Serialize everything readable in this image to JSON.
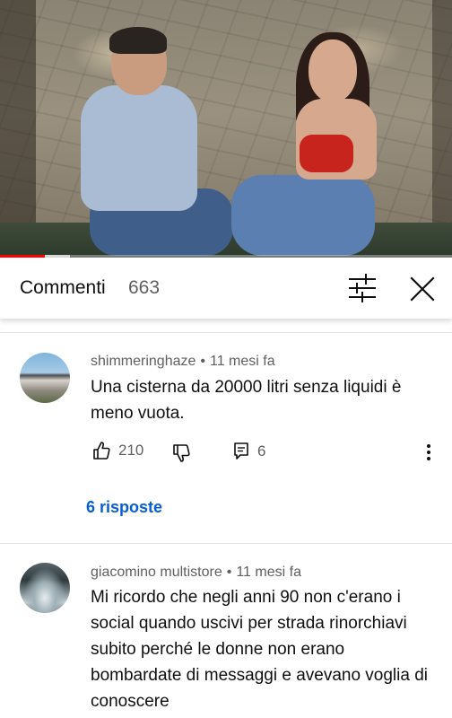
{
  "video": {
    "progress_fraction": 0.1,
    "buffered_fraction": 0.155
  },
  "comments_panel": {
    "title": "Commenti",
    "count": "663",
    "sort_icon": "sort-sliders-icon",
    "close_icon": "close-icon"
  },
  "comments": [
    {
      "author": "shimmeringhaze",
      "separator": "•",
      "time": "11 mesi fa",
      "text": "Una cisterna da 20000 litri senza liquidi è meno vuota.",
      "likes": "210",
      "replies_count": "6",
      "replies_link": "6 risposte"
    },
    {
      "author": "giacomino multistore",
      "separator": "•",
      "time": "11 mesi fa",
      "text": "Mi ricordo che negli anni 90 non c'erano i social quando uscivi per strada rinorchiavi subito perché le donne non erano bombardate di messaggi e avevano voglia di conoscere"
    }
  ],
  "colors": {
    "accent_link": "#065fd4",
    "progress": "#ff0000",
    "secondary_text": "#606060"
  }
}
